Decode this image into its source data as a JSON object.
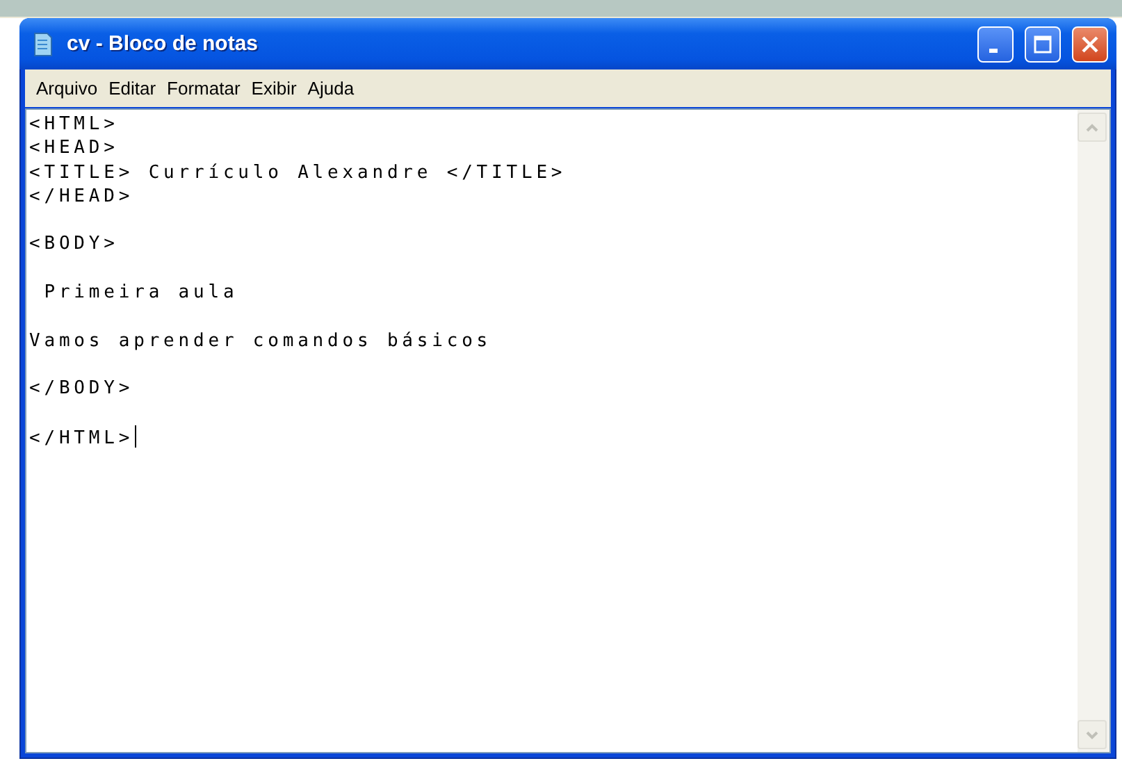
{
  "window": {
    "title": "cv - Bloco de notas"
  },
  "menu": [
    {
      "label": "Arquivo"
    },
    {
      "label": "Editar"
    },
    {
      "label": "Formatar"
    },
    {
      "label": "Exibir"
    },
    {
      "label": "Ajuda"
    }
  ],
  "document": {
    "lines": [
      {
        "kind": "text",
        "text": "<HTML>",
        "caret": false
      },
      {
        "kind": "text",
        "text": "<HEAD>",
        "caret": false
      },
      {
        "kind": "text",
        "text": "<TITLE> Currículo Alexandre </TITLE>",
        "caret": false
      },
      {
        "kind": "text",
        "text": "</HEAD>",
        "caret": false
      },
      {
        "kind": "blank"
      },
      {
        "kind": "text",
        "text": "<BODY>",
        "caret": false
      },
      {
        "kind": "blank"
      },
      {
        "kind": "text",
        "text": " Primeira aula",
        "caret": false
      },
      {
        "kind": "blank"
      },
      {
        "kind": "text",
        "text": "Vamos aprender comandos básicos",
        "caret": false
      },
      {
        "kind": "blank"
      },
      {
        "kind": "text",
        "text": "</BODY>",
        "caret": false
      },
      {
        "kind": "blank"
      },
      {
        "kind": "text",
        "text": "</HTML>",
        "caret": true
      }
    ]
  }
}
